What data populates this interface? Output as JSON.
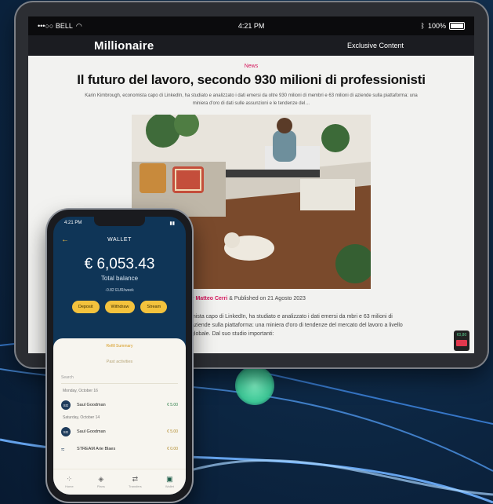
{
  "tablet": {
    "status": {
      "carrier": "•••○○ BELL",
      "time": "4:21 PM",
      "battery": "100%"
    },
    "header": {
      "brand": "Millionaire",
      "exclusive": "Exclusive Content"
    },
    "article": {
      "category": "News",
      "title": "Il futuro del lavoro, secondo 930 milioni di professionisti",
      "lead": "Karin Kimbrough, economista capo di LinkedIn, ha studiato e analizzato i dati emersi da oltre 930 milioni di membri e 63 milioni di aziende sulla piattaforma: una miniera d'oro di dati sulle assunzioni e le tendenze del…",
      "byline_prefix": "y",
      "author": "Matteo Cerri",
      "byline_suffix": "& Published on 21 Agosto 2023",
      "body": "mista capo di LinkedIn, ha studiato e analizzato i dati emersi da mbri e 63 milioni di aziende sulla piattaforma: una miniera d'oro di tendenze del mercato del lavoro a livello globale. Dal suo studio importanti:"
    },
    "cta": {
      "price": "€0,80",
      "button": ""
    }
  },
  "phone": {
    "status": {
      "time": "4:21 PM"
    },
    "wallet": {
      "title": "WALLET",
      "balance": "€ 6,053.43",
      "balance_label": "Total balance",
      "change": "-0.82 EUR/week",
      "actions": [
        "Deposit",
        "Withdraw",
        "Stream"
      ]
    },
    "sheet": {
      "title": "Refill Summary",
      "subtitle": "Past activities",
      "search_placeholder": "Search",
      "groups": [
        {
          "date": "Monday, October 16",
          "rows": [
            {
              "initials": "SG",
              "name": "Saul Goodman",
              "amount": "€ 5.00"
            }
          ]
        },
        {
          "date": "Saturday, October 14",
          "rows": [
            {
              "initials": "SG",
              "name": "Saul Goodman",
              "amount": "€ 5.00"
            },
            {
              "initials": "",
              "name": "STREAM Arie Blaes",
              "amount": "€ 0.00"
            }
          ]
        }
      ]
    },
    "nav": [
      {
        "icon": "home-icon",
        "label": "Home"
      },
      {
        "icon": "tag-icon",
        "label": "Plans"
      },
      {
        "icon": "transfer-icon",
        "label": "Transfers"
      },
      {
        "icon": "wallet-icon",
        "label": "Wallet"
      }
    ]
  },
  "colors": {
    "accent": "#f3c23d",
    "brand_pink": "#d4145a",
    "wallet_bg": "#0f3557",
    "glow": "#3dc796"
  }
}
